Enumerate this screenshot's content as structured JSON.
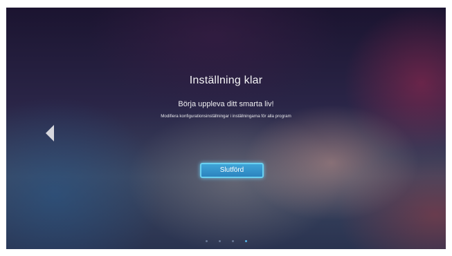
{
  "screen": {
    "title": "Inställning klar",
    "subtitle": "Börja uppleva ditt smarta liv!",
    "description": "Modifiera konfigurationsinställningar i inställningarna för alla program"
  },
  "navigation": {
    "back_icon": "chevron-left-icon"
  },
  "finish_button": {
    "label": "Slutförd"
  },
  "pager": {
    "total_steps": 4,
    "current_step": 4
  },
  "colors": {
    "accent": "#3fa4d8",
    "accent_glow": "#6ad0f0",
    "active_dot": "#56b4e6"
  }
}
